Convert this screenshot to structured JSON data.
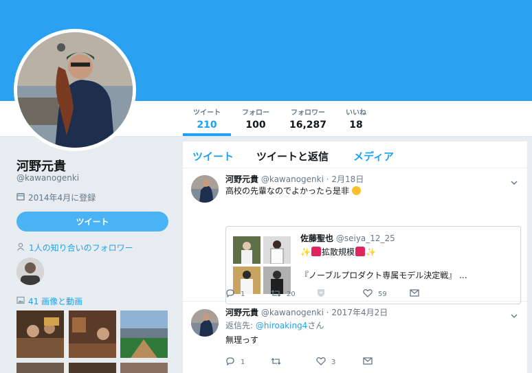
{
  "profile": {
    "name": "河野元貴",
    "handle": "@kawanogenki",
    "joined": "2014年4月に登録",
    "tweet_button": "ツイート",
    "followers_you_know": "1人の知り合いのフォロワー",
    "media_link": "41 画像と動画"
  },
  "stats": [
    {
      "label": "ツイート",
      "value": "210"
    },
    {
      "label": "フォロー",
      "value": "100"
    },
    {
      "label": "フォロワー",
      "value": "16,287"
    },
    {
      "label": "いいね",
      "value": "18"
    }
  ],
  "tabs": [
    {
      "label": "ツイート"
    },
    {
      "label": "ツイートと返信"
    },
    {
      "label": "メディア"
    }
  ],
  "tweets": [
    {
      "name": "河野元貴",
      "handle": "@kawanogenki",
      "date": "· 2月18日",
      "text": "高校の先輩なのでよかったら是非",
      "quote": {
        "name": "佐藤聖也",
        "handle": "@seiya_12_25",
        "line1": "拡散規模",
        "line2": "『ノーブルプロダクト専属モデル決定戦』 ..."
      },
      "replies": "1",
      "retweets": "20",
      "likes": "59"
    },
    {
      "name": "河野元貴",
      "handle": "@kawanogenki",
      "date": "· 2017年4月2日",
      "reply_prefix": "返信先:",
      "reply_handle": "@hiroaking4",
      "reply_suffix": "さん",
      "text": "無理っす",
      "replies": "1",
      "retweets": "",
      "likes": "3"
    }
  ],
  "colors": {
    "banner": "#2aa1f0",
    "accent": "#1da1f2",
    "button": "#4ab3f4",
    "background": "#e6ecf0"
  }
}
